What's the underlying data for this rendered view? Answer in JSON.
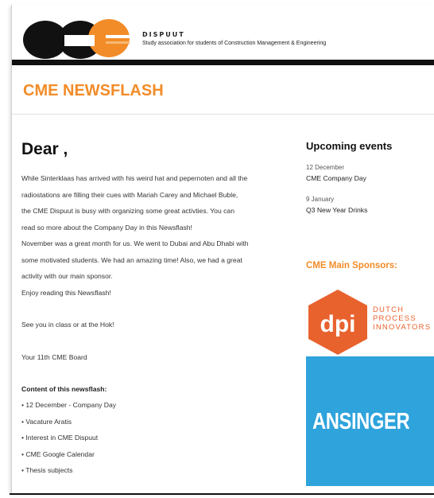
{
  "header": {
    "brand_name": "DISPUUT",
    "tagline": "Study association for students of Construction Management & Engineering",
    "logo_letters": "CME"
  },
  "newsflash_title": "CME NEWSFLASH",
  "main": {
    "greeting": "Dear ,",
    "lines": [
      "While Sinterklaas has arrived with his weird hat and pepernoten and all the",
      "radiostations are filling their cues with Mariah Carey and Michael Buble,",
      "the CME Dispuut is busy with organizing some great activties. You can",
      "read so more about the Company Day in this Newsflash!",
      "November was a great month for us. We went to Dubai and Abu Dhabi with",
      "some motivated students. We had an amazing time! Also, we had a great",
      "activity with our main sponsor.",
      "Enjoy reading this Newsflash!"
    ],
    "closing": "See you in class or at the Hok!",
    "signature": "Your 11th CME Board",
    "toc_title": "Content of this newsflash:",
    "toc_items": [
      "• 12 December - Company Day",
      "• Vacature Aratis",
      "• Interest in CME Dispuut",
      "• CME Google Calendar",
      "• Thesis subjects"
    ]
  },
  "sidebar": {
    "events_title": "Upcoming events",
    "events": [
      {
        "date": "12 December",
        "name": "CME Company Day"
      },
      {
        "date": "9 January",
        "name": "Q3 New Year Drinks"
      }
    ],
    "sponsors_title": "CME Main Sponsors:",
    "sponsors": [
      {
        "name": "dpi",
        "lines": [
          "DUTCH",
          "PROCESS",
          "INNOVATORS"
        ]
      },
      {
        "name": "ANSINGER"
      }
    ]
  },
  "colors": {
    "accent": "#f28c28",
    "dpi_orange": "#e8622e",
    "ansinger_blue": "#2ea3dc",
    "bar": "#111111"
  }
}
